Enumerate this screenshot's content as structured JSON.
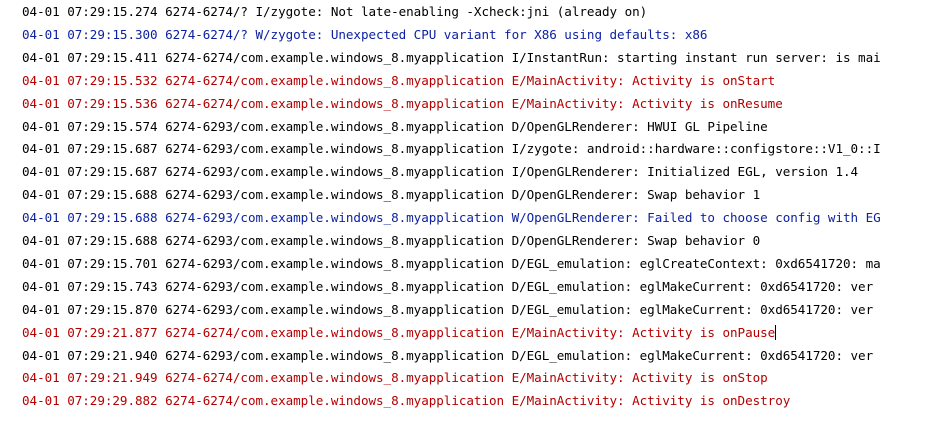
{
  "colors": {
    "background": "#ffffff",
    "info_debug": "#000000",
    "warning": "#0b1fa0",
    "error": "#b40000"
  },
  "log": {
    "lines": [
      {
        "level": "I",
        "text": "04-01 07:29:15.274 6274-6274/? I/zygote: Not late-enabling -Xcheck:jni (already on)"
      },
      {
        "level": "W",
        "text": "04-01 07:29:15.300 6274-6274/? W/zygote: Unexpected CPU variant for X86 using defaults: x86"
      },
      {
        "level": "I",
        "text": "04-01 07:29:15.411 6274-6274/com.example.windows_8.myapplication I/InstantRun: starting instant run server: is mai"
      },
      {
        "level": "E",
        "text": "04-01 07:29:15.532 6274-6274/com.example.windows_8.myapplication E/MainActivity: Activity is onStart"
      },
      {
        "level": "E",
        "text": "04-01 07:29:15.536 6274-6274/com.example.windows_8.myapplication E/MainActivity: Activity is onResume"
      },
      {
        "level": "D",
        "text": "04-01 07:29:15.574 6274-6293/com.example.windows_8.myapplication D/OpenGLRenderer: HWUI GL Pipeline"
      },
      {
        "level": "I",
        "text": "04-01 07:29:15.687 6274-6293/com.example.windows_8.myapplication I/zygote: android::hardware::configstore::V1_0::I"
      },
      {
        "level": "I",
        "text": "04-01 07:29:15.687 6274-6293/com.example.windows_8.myapplication I/OpenGLRenderer: Initialized EGL, version 1.4"
      },
      {
        "level": "D",
        "text": "04-01 07:29:15.688 6274-6293/com.example.windows_8.myapplication D/OpenGLRenderer: Swap behavior 1"
      },
      {
        "level": "W",
        "text": "04-01 07:29:15.688 6274-6293/com.example.windows_8.myapplication W/OpenGLRenderer: Failed to choose config with EG"
      },
      {
        "level": "D",
        "text": "04-01 07:29:15.688 6274-6293/com.example.windows_8.myapplication D/OpenGLRenderer: Swap behavior 0"
      },
      {
        "level": "D",
        "text": "04-01 07:29:15.701 6274-6293/com.example.windows_8.myapplication D/EGL_emulation: eglCreateContext: 0xd6541720: ma"
      },
      {
        "level": "D",
        "text": "04-01 07:29:15.743 6274-6293/com.example.windows_8.myapplication D/EGL_emulation: eglMakeCurrent: 0xd6541720: ver"
      },
      {
        "level": "D",
        "text": "04-01 07:29:15.870 6274-6293/com.example.windows_8.myapplication D/EGL_emulation: eglMakeCurrent: 0xd6541720: ver"
      },
      {
        "level": "E",
        "text": "04-01 07:29:21.877 6274-6274/com.example.windows_8.myapplication E/MainActivity: Activity is onPause"
      },
      {
        "level": "D",
        "text": "04-01 07:29:21.940 6274-6293/com.example.windows_8.myapplication D/EGL_emulation: eglMakeCurrent: 0xd6541720: ver"
      },
      {
        "level": "E",
        "text": "04-01 07:29:21.949 6274-6274/com.example.windows_8.myapplication E/MainActivity: Activity is onStop"
      },
      {
        "level": "E",
        "text": "04-01 07:29:29.882 6274-6274/com.example.windows_8.myapplication E/MainActivity: Activity is onDestroy"
      }
    ]
  }
}
